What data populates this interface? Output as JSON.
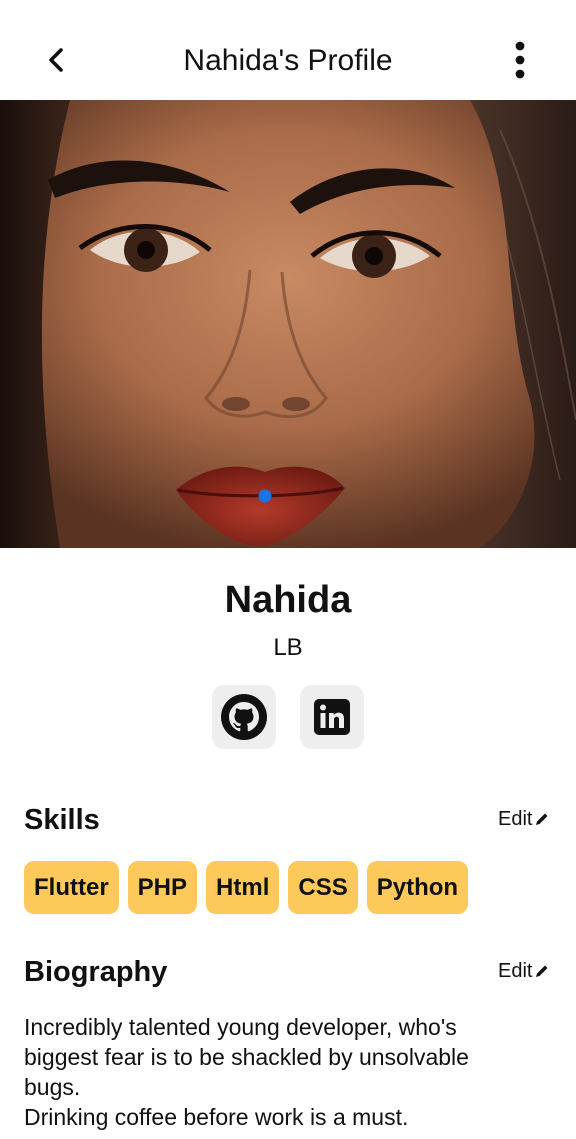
{
  "header": {
    "title": "Nahida's Profile",
    "back_icon": "chevron-left-icon",
    "menu_icon": "more-vertical-icon"
  },
  "cover": {
    "image": "portrait-photo"
  },
  "profile": {
    "name": "Nahida",
    "location": "LB",
    "social": [
      {
        "label": "github",
        "icon": "github-icon"
      },
      {
        "label": "linkedin",
        "icon": "linkedin-icon"
      }
    ]
  },
  "skills": {
    "title": "Skills",
    "edit_label": "Edit",
    "items": [
      "Flutter",
      "PHP",
      "Html",
      "CSS",
      "Python"
    ]
  },
  "biography": {
    "title": "Biography",
    "edit_label": "Edit",
    "lines": [
      "Incredibly talented young developer, who's",
      "biggest fear is to be shackled by unsolvable",
      "bugs.",
      "Drinking coffee before work is a must."
    ]
  },
  "colors": {
    "chip_bg": "#fcc95a",
    "social_bg": "#eeeeee",
    "text": "#111111",
    "indicator": "#1a73e8"
  }
}
